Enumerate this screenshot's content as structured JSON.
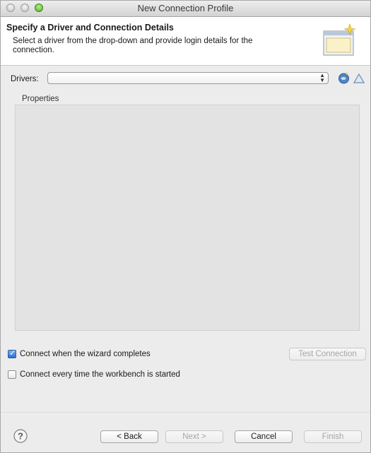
{
  "window": {
    "title": "New Connection Profile"
  },
  "banner": {
    "heading": "Specify a Driver and Connection Details",
    "description": "Select a driver from the drop-down and provide login details for the connection."
  },
  "drivers": {
    "label": "Drivers:",
    "selected_value": ""
  },
  "properties": {
    "label": "Properties"
  },
  "options": {
    "connect_on_finish": {
      "label": "Connect when the wizard completes",
      "checked": true
    },
    "connect_on_startup": {
      "label": "Connect every time the workbench is started",
      "checked": false
    }
  },
  "buttons": {
    "test_connection": "Test Connection",
    "back": "< Back",
    "next": "Next >",
    "cancel": "Cancel",
    "finish": "Finish"
  },
  "icons": {
    "new_driver": "new-driver-icon",
    "edit_driver": "edit-driver-icon",
    "help": "help-icon",
    "wizard_banner": "database-wizard-icon"
  },
  "colors": {
    "accent": "#2c6fd1",
    "properties_bg": "#e3e3e3"
  }
}
